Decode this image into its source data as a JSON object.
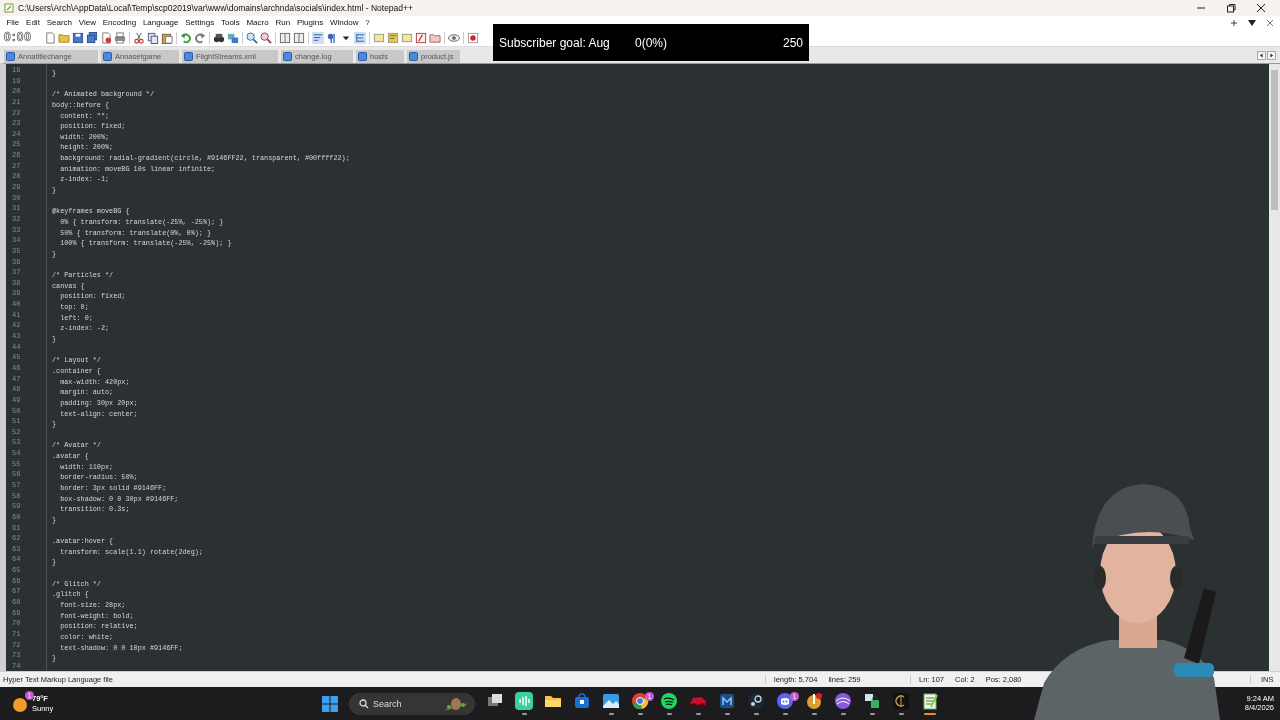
{
  "window": {
    "title": "C:\\Users\\Arch\\AppData\\Local\\Temp\\scp02019\\var\\www\\domains\\archnda\\socials\\index.html - Notepad++"
  },
  "menu": [
    "File",
    "Edit",
    "Search",
    "View",
    "Encoding",
    "Language",
    "Settings",
    "Tools",
    "Macro",
    "Run",
    "Plugins",
    "Window",
    "?"
  ],
  "toolbar": [
    {
      "kind": "new"
    },
    {
      "kind": "open"
    },
    {
      "kind": "save"
    },
    {
      "kind": "saveall"
    },
    {
      "kind": "close"
    },
    {
      "kind": "print"
    },
    {
      "kind": "sep"
    },
    {
      "kind": "cut"
    },
    {
      "kind": "copy"
    },
    {
      "kind": "paste"
    },
    {
      "kind": "sep"
    },
    {
      "kind": "undo"
    },
    {
      "kind": "redo"
    },
    {
      "kind": "sep"
    },
    {
      "kind": "find"
    },
    {
      "kind": "replace"
    },
    {
      "kind": "sep"
    },
    {
      "kind": "zoomin"
    },
    {
      "kind": "zoomout"
    },
    {
      "kind": "sep"
    },
    {
      "kind": "sync"
    },
    {
      "kind": "sync"
    },
    {
      "kind": "sep"
    },
    {
      "kind": "wrap"
    },
    {
      "kind": "pilcrow"
    },
    {
      "kind": "caret"
    },
    {
      "kind": "indent"
    },
    {
      "kind": "sep"
    },
    {
      "kind": "panel"
    },
    {
      "kind": "map"
    },
    {
      "kind": "panel"
    },
    {
      "kind": "func"
    },
    {
      "kind": "folder"
    },
    {
      "kind": "sep"
    },
    {
      "kind": "eye"
    },
    {
      "kind": "sep"
    },
    {
      "kind": "record"
    }
  ],
  "stream_timer": "0:00",
  "tabs": [
    {
      "label": "Annatitlechange"
    },
    {
      "label": "Annasetgame"
    },
    {
      "label": "FlightStreams.xml"
    },
    {
      "label": "change.log"
    },
    {
      "label": "hosts"
    },
    {
      "label": "product.js"
    }
  ],
  "subscriber_goal": {
    "label": "Subscriber goal: Aug",
    "progress": "0(0%)",
    "target": "250",
    "level": 0
  },
  "editor": {
    "lines": [
      {
        "number": "18",
        "text": "}"
      },
      {
        "number": "19"
      },
      {
        "number": "20",
        "text": "/* Animated background */"
      },
      {
        "number": "21",
        "text": "body::before {"
      },
      {
        "number": "22",
        "text": "  content: \"\";"
      },
      {
        "number": "23",
        "text": "  position: fixed;"
      },
      {
        "number": "24",
        "text": "  width: 200%;"
      },
      {
        "number": "25",
        "text": "  height: 200%;"
      },
      {
        "number": "26",
        "text": "  background: radial-gradient(circle, #9146FF22, transparent, #00ffff22);"
      },
      {
        "number": "27",
        "text": "  animation: moveBG 10s linear infinite;"
      },
      {
        "number": "28",
        "text": "  z-index: -1;"
      },
      {
        "number": "29",
        "text": "}"
      },
      {
        "number": "30"
      },
      {
        "number": "31",
        "text": "@keyframes moveBG {"
      },
      {
        "number": "32",
        "text": "  0% { transform: translate(-25%, -25%); }"
      },
      {
        "number": "33",
        "text": "  50% { transform: translate(0%, 0%); }"
      },
      {
        "number": "34",
        "text": "  100% { transform: translate(-25%, -25%); }"
      },
      {
        "number": "35",
        "text": "}"
      },
      {
        "number": "36"
      },
      {
        "number": "37",
        "text": "/* Particles */"
      },
      {
        "number": "38",
        "text": "canvas {"
      },
      {
        "number": "39",
        "text": "  position: fixed;"
      },
      {
        "number": "40",
        "text": "  top: 0;"
      },
      {
        "number": "41",
        "text": "  left: 0;"
      },
      {
        "number": "42",
        "text": "  z-index: -2;"
      },
      {
        "number": "43",
        "text": "}"
      },
      {
        "number": "44"
      },
      {
        "number": "45",
        "text": "/* Layout */"
      },
      {
        "number": "46",
        "text": ".container {"
      },
      {
        "number": "47",
        "text": "  max-width: 420px;"
      },
      {
        "number": "48",
        "text": "  margin: auto;"
      },
      {
        "number": "49",
        "text": "  padding: 30px 20px;"
      },
      {
        "number": "50",
        "text": "  text-align: center;"
      },
      {
        "number": "51",
        "text": "}"
      },
      {
        "number": "52"
      },
      {
        "number": "53",
        "text": "/* Avatar */"
      },
      {
        "number": "54",
        "text": ".avatar {"
      },
      {
        "number": "55",
        "text": "  width: 110px;"
      },
      {
        "number": "56",
        "text": "  border-radius: 50%;"
      },
      {
        "number": "57",
        "text": "  border: 3px solid #9146FF;"
      },
      {
        "number": "58",
        "text": "  box-shadow: 0 0 30px #9146FF;"
      },
      {
        "number": "59",
        "text": "  transition: 0.3s;"
      },
      {
        "number": "60",
        "text": "}"
      },
      {
        "number": "61"
      },
      {
        "number": "62",
        "text": ".avatar:hover {"
      },
      {
        "number": "63",
        "text": "  transform: scale(1.1) rotate(2deg);"
      },
      {
        "number": "64",
        "text": "}"
      },
      {
        "number": "65"
      },
      {
        "number": "66",
        "text": "/* Glitch */"
      },
      {
        "number": "67",
        "text": ".glitch {"
      },
      {
        "number": "68",
        "text": "  font-size: 28px;"
      },
      {
        "number": "69",
        "text": "  font-weight: bold;"
      },
      {
        "number": "70",
        "text": "  position: relative;"
      },
      {
        "number": "71",
        "text": "  color: white;"
      },
      {
        "number": "72",
        "text": "  text-shadow: 0 0 10px #9146FF;"
      },
      {
        "number": "73",
        "text": "}"
      },
      {
        "number": "74"
      }
    ]
  },
  "status_bar": {
    "file_type": "Hyper Text Markup Language file",
    "length": "length: 5,704",
    "lines": "lines: 259",
    "line": "Ln: 107",
    "column": "Col: 2",
    "position": "Pos: 2,080",
    "mode": "INS"
  },
  "taskbar": {
    "weather": {
      "temperature": "79°F",
      "condition": "Sunny",
      "badge": "1"
    },
    "search": {
      "placeholder": "Search"
    },
    "apps": [
      {
        "kind": "taskview",
        "running": false,
        "selected": false
      },
      {
        "kind": "voice",
        "running": true,
        "selected": false
      },
      {
        "kind": "folder",
        "running": false,
        "selected": false
      },
      {
        "kind": "store",
        "running": false,
        "selected": false
      },
      {
        "kind": "photos",
        "running": true,
        "selected": false
      },
      {
        "kind": "browser",
        "running": true,
        "selected": false,
        "badge": "1"
      },
      {
        "kind": "music",
        "running": true,
        "selected": false
      },
      {
        "kind": "car",
        "running": true,
        "selected": false
      },
      {
        "kind": "tile",
        "running": true,
        "selected": false
      },
      {
        "kind": "steam",
        "running": true,
        "selected": false
      },
      {
        "kind": "chat",
        "running": true,
        "selected": false,
        "badge": "1"
      },
      {
        "kind": "game",
        "running": true,
        "selected": false
      },
      {
        "kind": "sphere",
        "running": true,
        "selected": false
      },
      {
        "kind": "lock",
        "running": true,
        "selected": false
      },
      {
        "kind": "coin",
        "running": true,
        "selected": false
      },
      {
        "kind": "notepad",
        "running": true,
        "selected": true
      }
    ],
    "clock": {
      "time": "9:24 AM",
      "date": "8/4/2026"
    }
  }
}
